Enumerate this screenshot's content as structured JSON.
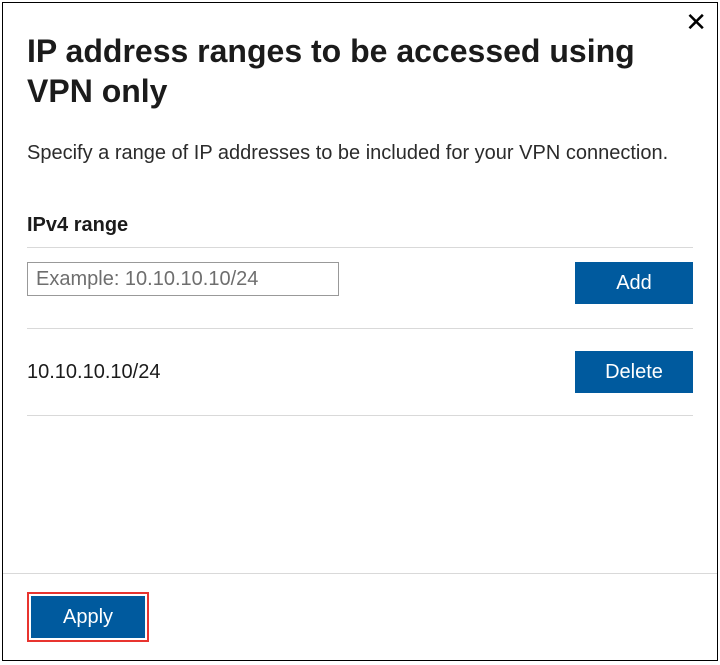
{
  "dialog": {
    "title": "IP address ranges to be accessed using VPN only",
    "description": "Specify a range of IP addresses to be included for your VPN connection.",
    "section_label": "IPv4 range",
    "input_placeholder": "Example: 10.10.10.10/24",
    "add_button": "Add",
    "delete_button": "Delete",
    "apply_button": "Apply"
  },
  "entries": [
    {
      "value": "10.10.10.10/24"
    }
  ]
}
